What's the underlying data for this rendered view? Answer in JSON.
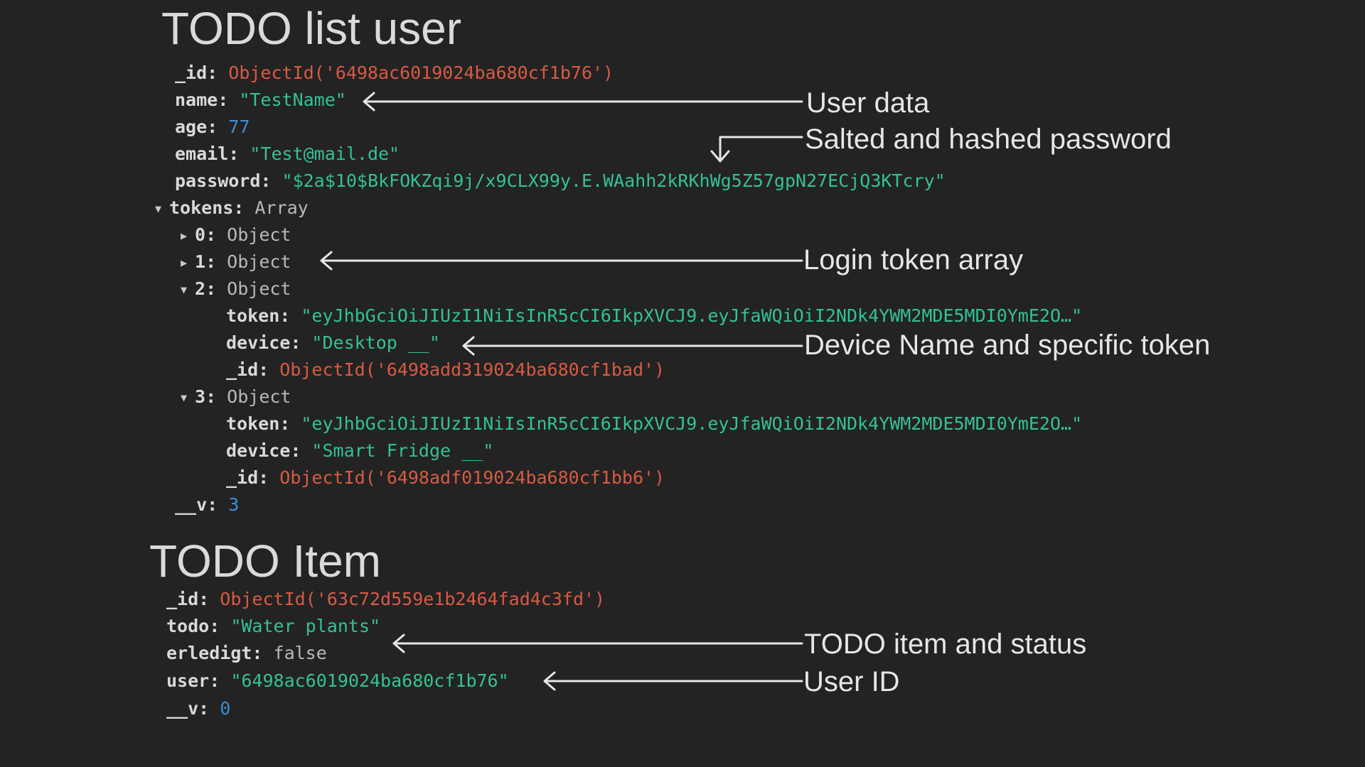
{
  "headings": {
    "user_title": "TODO list user",
    "item_title": "TODO Item"
  },
  "user_doc": {
    "id_key": "_id",
    "id_value": "ObjectId('6498ac6019024ba680cf1b76')",
    "name_key": "name",
    "name_value": "\"TestName\"",
    "age_key": "age",
    "age_value": "77",
    "email_key": "email",
    "email_value": "\"Test@mail.de\"",
    "password_key": "password",
    "password_value": "\"$2a$10$BkFOKZqi9j/x9CLX99y.E.WAahh2kRKhWg5Z57gpN27ECjQ3KTcry\"",
    "tokens_key": "tokens",
    "tokens_type": "Array",
    "tokens": [
      {
        "index": "0",
        "type": "Object",
        "expanded": false
      },
      {
        "index": "1",
        "type": "Object",
        "expanded": false
      },
      {
        "index": "2",
        "type": "Object",
        "expanded": true,
        "token_key": "token",
        "token_value": "\"eyJhbGciOiJIUzI1NiIsInR5cCI6IkpXVCJ9.eyJfaWQiOiI2NDk4YWM2MDE5MDI0YmE2O…\"",
        "device_key": "device",
        "device_value": "\"Desktop __\"",
        "id_key": "_id",
        "id_value": "ObjectId('6498add319024ba680cf1bad')"
      },
      {
        "index": "3",
        "type": "Object",
        "expanded": true,
        "token_key": "token",
        "token_value": "\"eyJhbGciOiJIUzI1NiIsInR5cCI6IkpXVCJ9.eyJfaWQiOiI2NDk4YWM2MDE5MDI0YmE2O…\"",
        "device_key": "device",
        "device_value": "\"Smart Fridge __\"",
        "id_key": "_id",
        "id_value": "ObjectId('6498adf019024ba680cf1bb6')"
      }
    ],
    "v_key": "__v",
    "v_value": "3"
  },
  "item_doc": {
    "id_key": "_id",
    "id_value": "ObjectId('63c72d559e1b2464fad4c3fd')",
    "todo_key": "todo",
    "todo_value": "\"Water plants\"",
    "erledigt_key": "erledigt",
    "erledigt_value": "false",
    "user_key": "user",
    "user_value": "\"6498ac6019024ba680cf1b76\"",
    "v_key": "__v",
    "v_value": "0"
  },
  "annotations": {
    "user_data": "User data",
    "password": "Salted and hashed password",
    "tokens": "Login token array",
    "device": "Device Name and specific token",
    "item_status": "TODO item and status",
    "user_id": "User ID"
  },
  "colors": {
    "background": "#232323",
    "key": "#d9d9d9",
    "string": "#34c197",
    "object_id": "#d95a43",
    "number": "#3b8fd6",
    "plain": "#b9b9b9",
    "annotation": "#e6e6e6",
    "heading": "#dadada"
  },
  "icons": {
    "expanded": "caret-down-icon",
    "collapsed": "caret-right-icon"
  }
}
